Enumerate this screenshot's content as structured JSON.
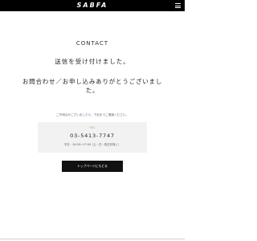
{
  "header": {
    "logo": "SABFA",
    "menu_icon": "hamburger-icon"
  },
  "contact": {
    "title": "CONTACT",
    "message_received": "送信を受け付けました。",
    "message_thanks": "お問合わせ／お申し込みありがとうございました。",
    "note": "ご不明点がございましたら、下記までご連絡ください。",
    "tel_label": "TEL",
    "tel_number": "03-5413-7747",
    "tel_hours": "平日：10:00〜17:00（土・日・祝日を除く）",
    "top_button_label": "トップページにもどる"
  },
  "colors": {
    "header_bg": "#000000",
    "tel_label": "#9a9a33",
    "button_bg": "#111111",
    "panel_bg": "#f2f2f2"
  }
}
